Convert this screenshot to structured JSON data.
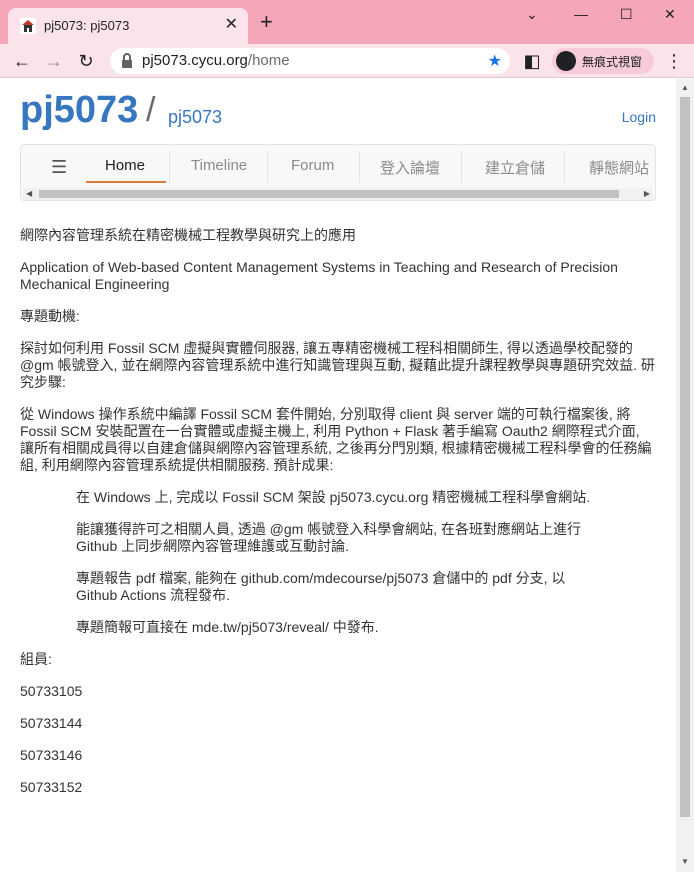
{
  "browser": {
    "tab_title": "pj5073: pj5073",
    "url_host": "pj5073.cycu.org",
    "url_path": "/home",
    "incognito_label": "無痕式視窗"
  },
  "header": {
    "brand": "pj5073",
    "slash": "/",
    "subtitle": "pj5073",
    "login": "Login"
  },
  "nav": {
    "items": [
      {
        "label": "Home"
      },
      {
        "label": "Timeline"
      },
      {
        "label": "Forum"
      },
      {
        "label": "登入論壇"
      },
      {
        "label": "建立倉儲"
      },
      {
        "label": "靜態網站"
      }
    ]
  },
  "content": {
    "p1": "網際內容管理系統在精密機械工程教學與研究上的應用",
    "p2": "Application of Web-based Content Management Systems in Teaching and Research of Precision Mechanical Engineering",
    "p3": "專題動機:",
    "p4": "探討如何利用 Fossil SCM 虛擬與實體伺服器, 讓五專精密機械工程科相關師生, 得以透過學校配發的 @gm 帳號登入, 並在網際內容管理系統中進行知識管理與互動, 擬藉此提升課程教學與專題研究效益. 研究步驟:",
    "p5": "從 Windows 操作系統中編譯 Fossil SCM 套件開始, 分別取得 client 與 server 端的可執行檔案後, 將 Fossil SCM 安裝配置在一台實體或虛擬主機上, 利用 Python + Flask 著手編寫 Oauth2 網際程式介面, 讓所有相關成員得以自建倉儲與網際內容管理系統, 之後再分門別類, 根據精密機械工程科學會的任務編組, 利用網際內容管理系統提供相關服務. 預計成果:",
    "q1": "在 Windows 上, 完成以 Fossil SCM 架設 pj5073.cycu.org 精密機械工程科學會網站.",
    "q2": "能讓獲得許可之相關人員, 透過 @gm 帳號登入科學會網站, 在各班對應網站上進行 Github 上同步網際內容管理維護或互動討論.",
    "q3": "專題報告 pdf 檔案, 能夠在 github.com/mdecourse/pj5073 倉儲中的 pdf 分支, 以 Github Actions 流程發布.",
    "q4": "專題簡報可直接在 mde.tw/pj5073/reveal/ 中發布.",
    "members_label": "組員:",
    "members": [
      "50733105",
      "50733144",
      "50733146",
      "50733152"
    ]
  }
}
